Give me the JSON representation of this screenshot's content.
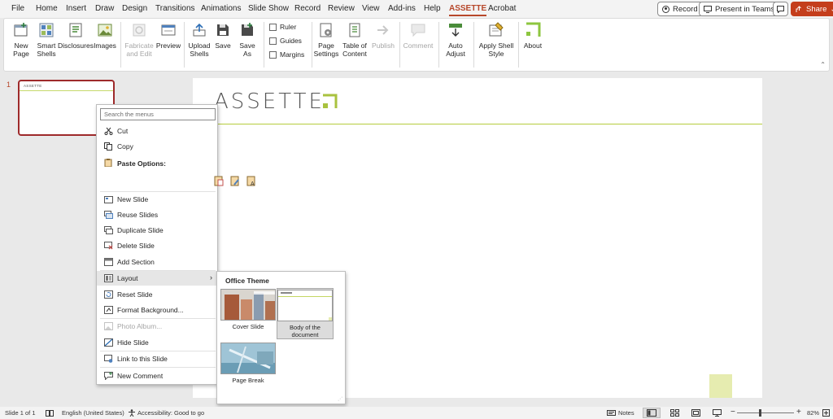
{
  "menu": {
    "tabs": [
      "File",
      "Home",
      "Insert",
      "Draw",
      "Design",
      "Transitions",
      "Animations",
      "Slide Show",
      "Record",
      "Review",
      "View",
      "Add-ins",
      "Help",
      "ASSETTE",
      "Acrobat"
    ],
    "active_tab": "ASSETTE",
    "record_label": "Record",
    "present_label": "Present in Teams",
    "share_label": "Share"
  },
  "ribbon": {
    "new_page": "New Page",
    "smart_shells": "Smart Shells",
    "disclosures": "Disclosures",
    "images": "Images",
    "fabricate": "Fabricate and Edit",
    "preview": "Preview",
    "upload_shells": "Upload Shells",
    "save": "Save",
    "save_as": "Save As",
    "ruler": "Ruler",
    "guides": "Guides",
    "margins": "Margins",
    "page_settings": "Page Settings",
    "table_of_content": "Table of Content",
    "publish": "Publish",
    "comment": "Comment",
    "auto_adjust": "Auto Adjust",
    "apply_shell_style": "Apply Shell Style",
    "about": "About"
  },
  "slides": {
    "number": "1",
    "logo_text": "ASSETTE"
  },
  "context_menu": {
    "search_placeholder": "Search the menus",
    "cut": "Cut",
    "copy": "Copy",
    "paste_options": "Paste Options:",
    "new_slide": "New Slide",
    "reuse_slides": "Reuse Slides",
    "duplicate_slide": "Duplicate Slide",
    "delete_slide": "Delete Slide",
    "add_section": "Add Section",
    "layout": "Layout",
    "reset_slide": "Reset Slide",
    "format_background": "Format Background...",
    "photo_album": "Photo Album...",
    "hide_slide": "Hide Slide",
    "link_to_slide": "Link to this Slide",
    "new_comment": "New Comment"
  },
  "layout_submenu": {
    "title": "Office Theme",
    "items": [
      "Cover Slide",
      "Body of the document",
      "Page Break"
    ]
  },
  "status": {
    "slide_info": "Slide 1 of 1",
    "language": "English (United States)",
    "accessibility": "Accessibility: Good to go",
    "notes": "Notes",
    "zoom": "82%"
  },
  "colors": {
    "accent": "#b7472a",
    "brand_green": "#b5cc3d",
    "share": "#c43e1c"
  }
}
